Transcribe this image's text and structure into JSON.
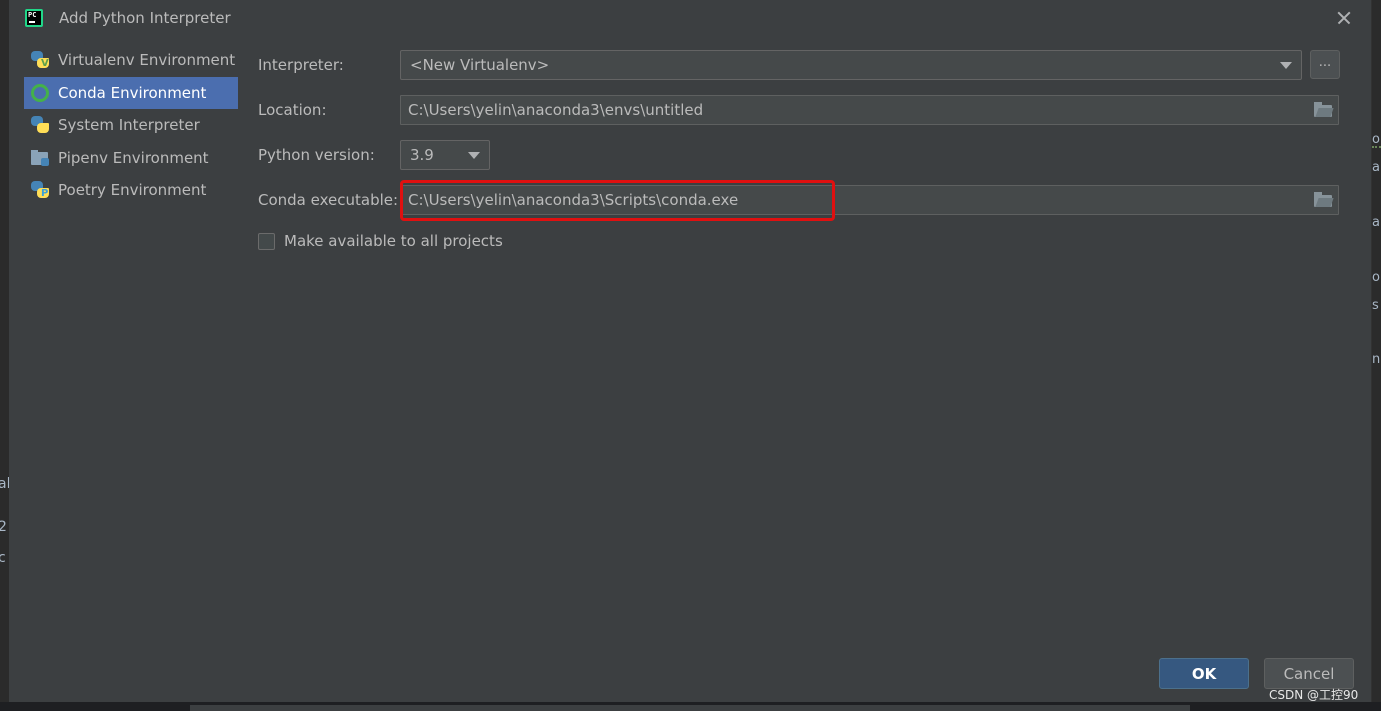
{
  "dialog": {
    "title": "Add Python Interpreter"
  },
  "sidebar": {
    "items": [
      {
        "label": "Virtualenv Environment",
        "icon": "python-virtualenv-icon"
      },
      {
        "label": "Conda Environment",
        "icon": "conda-icon",
        "selected": true
      },
      {
        "label": "System Interpreter",
        "icon": "python-icon"
      },
      {
        "label": "Pipenv Environment",
        "icon": "pipenv-folder-icon"
      },
      {
        "label": "Poetry Environment",
        "icon": "python-poetry-icon"
      }
    ]
  },
  "form": {
    "interpreter_label": "Interpreter:",
    "interpreter_value": "<New Virtualenv>",
    "browse_label": "...",
    "location_label": "Location:",
    "location_value": "C:\\Users\\yelin\\anaconda3\\envs\\untitled",
    "python_version_label": "Python version:",
    "python_version_value": "3.9",
    "conda_exec_label": "Conda executable:",
    "conda_exec_value": "C:\\Users\\yelin\\anaconda3\\Scripts\\conda.exe",
    "make_available_label": "Make available to all projects",
    "make_available_checked": false
  },
  "buttons": {
    "ok_label": "OK",
    "cancel_label": "Cancel"
  },
  "background": {
    "left_fragments": [
      "al.",
      "2",
      "c"
    ],
    "right_fragments": [
      "o",
      "a",
      "a",
      "o",
      "s",
      "n"
    ]
  },
  "watermark": "CSDN @工控90",
  "colors": {
    "dialog_bg": "#3c3f41",
    "selection": "#4b6eaf",
    "ok_button": "#365880",
    "highlight_box": "#e01010"
  }
}
